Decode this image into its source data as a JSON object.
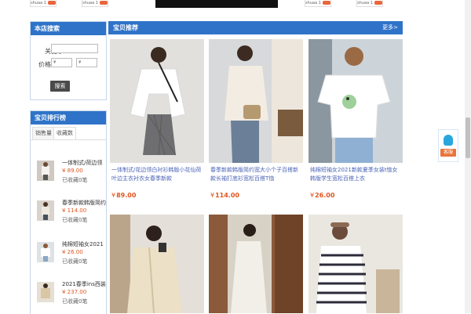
{
  "top_strip": {
    "tags": [
      "shuaa 1",
      "shuaa 1",
      "shuaa 1",
      "shuaa 1"
    ]
  },
  "store_search": {
    "title": "本店搜索",
    "keyword_label": "关键字",
    "keyword_value": "",
    "price_label": "价格",
    "price_min_placeholder": "¥",
    "price_max_placeholder": "¥",
    "search_button": "搜索"
  },
  "ranking": {
    "title": "宝贝排行榜",
    "tabs": [
      "销售量",
      "收藏数"
    ],
    "active_tab": 1,
    "items": [
      {
        "title": "一体制式/荷边领",
        "price": "¥ 89.00",
        "collected": "已收藏0笔"
      },
      {
        "title": "春季新款韩版简约",
        "price": "¥ 114.00",
        "collected": "已收藏0笔"
      },
      {
        "title": "纯棉短袖女2021",
        "price": "¥ 26.00",
        "collected": "已收藏0笔"
      },
      {
        "title": "2021春季ins西装",
        "price": "¥ 237.00",
        "collected": "已收藏0笔"
      }
    ]
  },
  "recommend": {
    "title": "宝贝推荐",
    "more": "更多>",
    "products": [
      {
        "title": "一体制式/花边领白衬衫韩版小花仙荷叶边主衣衬衣女春季新款",
        "currency": "¥",
        "price": "89.00"
      },
      {
        "title": "春季新款韩版简约宽大小个子百搭新款长袖打底衫宽松百搭T恤",
        "currency": "¥",
        "price": "114.00"
      },
      {
        "title": "纯棉短袖女2021新款夏季女装t恤女韩版学生宽松百搭上衣",
        "currency": "¥",
        "price": "26.00"
      },
      {
        "title": "",
        "currency": "",
        "price": ""
      },
      {
        "title": "",
        "currency": "",
        "price": ""
      },
      {
        "title": "",
        "currency": "",
        "price": ""
      }
    ]
  },
  "float_widget": {
    "label": "客服",
    "icon": "customer-service-icon"
  },
  "colors": {
    "accent": "#2f73c9",
    "price": "#e0561f",
    "link": "#4a63b5",
    "widget": "#e9743b"
  }
}
